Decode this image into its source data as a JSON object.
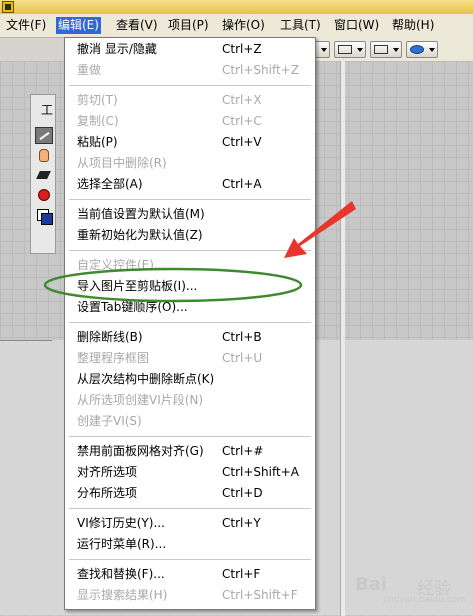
{
  "menubar": {
    "items": [
      {
        "label": "文件(F)"
      },
      {
        "label": "编辑(E)"
      },
      {
        "label": "查看(V)"
      },
      {
        "label": "项目(P)"
      },
      {
        "label": "操作(O)"
      },
      {
        "label": "工具(T)"
      },
      {
        "label": "窗口(W)"
      },
      {
        "label": "帮助(H)"
      }
    ],
    "active_index": 1
  },
  "palette": {
    "title": "工"
  },
  "edit_menu": {
    "items": [
      {
        "label": "撤消 显示/隐藏",
        "shortcut": "Ctrl+Z",
        "enabled": true
      },
      {
        "label": "重做",
        "shortcut": "Ctrl+Shift+Z",
        "enabled": false
      },
      {
        "label": "剪切(T)",
        "shortcut": "Ctrl+X",
        "enabled": false
      },
      {
        "label": "复制(C)",
        "shortcut": "Ctrl+C",
        "enabled": false
      },
      {
        "label": "粘贴(P)",
        "shortcut": "Ctrl+V",
        "enabled": true
      },
      {
        "label": "从项目中删除(R)",
        "shortcut": "",
        "enabled": false
      },
      {
        "label": "选择全部(A)",
        "shortcut": "Ctrl+A",
        "enabled": true
      },
      {
        "label": "当前值设置为默认值(M)",
        "shortcut": "",
        "enabled": true
      },
      {
        "label": "重新初始化为默认值(Z)",
        "shortcut": "",
        "enabled": true
      },
      {
        "label": "自定义控件(E)...",
        "shortcut": "",
        "enabled": false
      },
      {
        "label": "导入图片至剪贴板(I)...",
        "shortcut": "",
        "enabled": true
      },
      {
        "label": "设置Tab键顺序(O)...",
        "shortcut": "",
        "enabled": true
      },
      {
        "label": "删除断线(B)",
        "shortcut": "Ctrl+B",
        "enabled": true
      },
      {
        "label": "整理程序框图",
        "shortcut": "Ctrl+U",
        "enabled": false
      },
      {
        "label": "从层次结构中删除断点(K)",
        "shortcut": "",
        "enabled": true
      },
      {
        "label": "从所选项创建VI片段(N)",
        "shortcut": "",
        "enabled": false
      },
      {
        "label": "创建子VI(S)",
        "shortcut": "",
        "enabled": false
      },
      {
        "label": "禁用前面板网格对齐(G)",
        "shortcut": "Ctrl+#",
        "enabled": true
      },
      {
        "label": "对齐所选项",
        "shortcut": "Ctrl+Shift+A",
        "enabled": true
      },
      {
        "label": "分布所选项",
        "shortcut": "Ctrl+D",
        "enabled": true
      },
      {
        "label": "VI修订历史(Y)...",
        "shortcut": "Ctrl+Y",
        "enabled": true
      },
      {
        "label": "运行时菜单(R)...",
        "shortcut": "",
        "enabled": true
      },
      {
        "label": "查找和替换(F)...",
        "shortcut": "Ctrl+F",
        "enabled": true
      },
      {
        "label": "显示搜索结果(H)",
        "shortcut": "Ctrl+Shift+F",
        "enabled": false
      }
    ]
  },
  "annotations": {
    "arrow_color": "#e8362c",
    "ellipse_color": "#3f8a2e"
  },
  "watermark": {
    "logo": "Bai",
    "sub": "经验",
    "url": "jingyan.baidu.com"
  },
  "colors": {
    "menu_highlight": "#3168d5",
    "disabled_text": "#a8a8a8"
  }
}
